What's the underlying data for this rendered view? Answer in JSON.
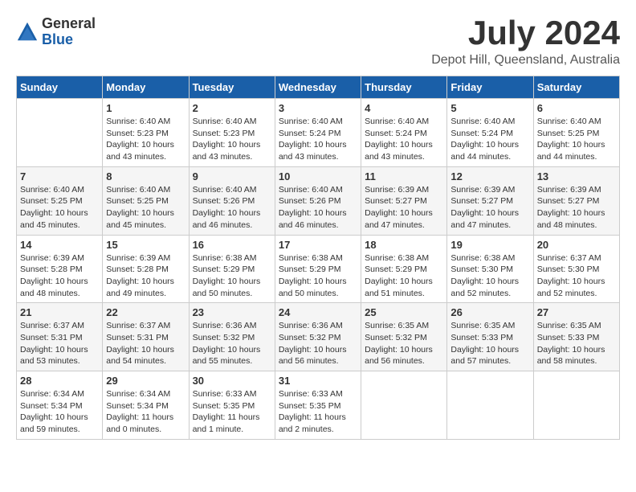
{
  "app": {
    "logo_general": "General",
    "logo_blue": "Blue"
  },
  "header": {
    "month_year": "July 2024",
    "location": "Depot Hill, Queensland, Australia"
  },
  "weekdays": [
    "Sunday",
    "Monday",
    "Tuesday",
    "Wednesday",
    "Thursday",
    "Friday",
    "Saturday"
  ],
  "weeks": [
    [
      {
        "day": "",
        "info": ""
      },
      {
        "day": "1",
        "info": "Sunrise: 6:40 AM\nSunset: 5:23 PM\nDaylight: 10 hours\nand 43 minutes."
      },
      {
        "day": "2",
        "info": "Sunrise: 6:40 AM\nSunset: 5:23 PM\nDaylight: 10 hours\nand 43 minutes."
      },
      {
        "day": "3",
        "info": "Sunrise: 6:40 AM\nSunset: 5:24 PM\nDaylight: 10 hours\nand 43 minutes."
      },
      {
        "day": "4",
        "info": "Sunrise: 6:40 AM\nSunset: 5:24 PM\nDaylight: 10 hours\nand 43 minutes."
      },
      {
        "day": "5",
        "info": "Sunrise: 6:40 AM\nSunset: 5:24 PM\nDaylight: 10 hours\nand 44 minutes."
      },
      {
        "day": "6",
        "info": "Sunrise: 6:40 AM\nSunset: 5:25 PM\nDaylight: 10 hours\nand 44 minutes."
      }
    ],
    [
      {
        "day": "7",
        "info": "Sunrise: 6:40 AM\nSunset: 5:25 PM\nDaylight: 10 hours\nand 45 minutes."
      },
      {
        "day": "8",
        "info": "Sunrise: 6:40 AM\nSunset: 5:25 PM\nDaylight: 10 hours\nand 45 minutes."
      },
      {
        "day": "9",
        "info": "Sunrise: 6:40 AM\nSunset: 5:26 PM\nDaylight: 10 hours\nand 46 minutes."
      },
      {
        "day": "10",
        "info": "Sunrise: 6:40 AM\nSunset: 5:26 PM\nDaylight: 10 hours\nand 46 minutes."
      },
      {
        "day": "11",
        "info": "Sunrise: 6:39 AM\nSunset: 5:27 PM\nDaylight: 10 hours\nand 47 minutes."
      },
      {
        "day": "12",
        "info": "Sunrise: 6:39 AM\nSunset: 5:27 PM\nDaylight: 10 hours\nand 47 minutes."
      },
      {
        "day": "13",
        "info": "Sunrise: 6:39 AM\nSunset: 5:27 PM\nDaylight: 10 hours\nand 48 minutes."
      }
    ],
    [
      {
        "day": "14",
        "info": "Sunrise: 6:39 AM\nSunset: 5:28 PM\nDaylight: 10 hours\nand 48 minutes."
      },
      {
        "day": "15",
        "info": "Sunrise: 6:39 AM\nSunset: 5:28 PM\nDaylight: 10 hours\nand 49 minutes."
      },
      {
        "day": "16",
        "info": "Sunrise: 6:38 AM\nSunset: 5:29 PM\nDaylight: 10 hours\nand 50 minutes."
      },
      {
        "day": "17",
        "info": "Sunrise: 6:38 AM\nSunset: 5:29 PM\nDaylight: 10 hours\nand 50 minutes."
      },
      {
        "day": "18",
        "info": "Sunrise: 6:38 AM\nSunset: 5:29 PM\nDaylight: 10 hours\nand 51 minutes."
      },
      {
        "day": "19",
        "info": "Sunrise: 6:38 AM\nSunset: 5:30 PM\nDaylight: 10 hours\nand 52 minutes."
      },
      {
        "day": "20",
        "info": "Sunrise: 6:37 AM\nSunset: 5:30 PM\nDaylight: 10 hours\nand 52 minutes."
      }
    ],
    [
      {
        "day": "21",
        "info": "Sunrise: 6:37 AM\nSunset: 5:31 PM\nDaylight: 10 hours\nand 53 minutes."
      },
      {
        "day": "22",
        "info": "Sunrise: 6:37 AM\nSunset: 5:31 PM\nDaylight: 10 hours\nand 54 minutes."
      },
      {
        "day": "23",
        "info": "Sunrise: 6:36 AM\nSunset: 5:32 PM\nDaylight: 10 hours\nand 55 minutes."
      },
      {
        "day": "24",
        "info": "Sunrise: 6:36 AM\nSunset: 5:32 PM\nDaylight: 10 hours\nand 56 minutes."
      },
      {
        "day": "25",
        "info": "Sunrise: 6:35 AM\nSunset: 5:32 PM\nDaylight: 10 hours\nand 56 minutes."
      },
      {
        "day": "26",
        "info": "Sunrise: 6:35 AM\nSunset: 5:33 PM\nDaylight: 10 hours\nand 57 minutes."
      },
      {
        "day": "27",
        "info": "Sunrise: 6:35 AM\nSunset: 5:33 PM\nDaylight: 10 hours\nand 58 minutes."
      }
    ],
    [
      {
        "day": "28",
        "info": "Sunrise: 6:34 AM\nSunset: 5:34 PM\nDaylight: 10 hours\nand 59 minutes."
      },
      {
        "day": "29",
        "info": "Sunrise: 6:34 AM\nSunset: 5:34 PM\nDaylight: 11 hours\nand 0 minutes."
      },
      {
        "day": "30",
        "info": "Sunrise: 6:33 AM\nSunset: 5:35 PM\nDaylight: 11 hours\nand 1 minute."
      },
      {
        "day": "31",
        "info": "Sunrise: 6:33 AM\nSunset: 5:35 PM\nDaylight: 11 hours\nand 2 minutes."
      },
      {
        "day": "",
        "info": ""
      },
      {
        "day": "",
        "info": ""
      },
      {
        "day": "",
        "info": ""
      }
    ]
  ]
}
